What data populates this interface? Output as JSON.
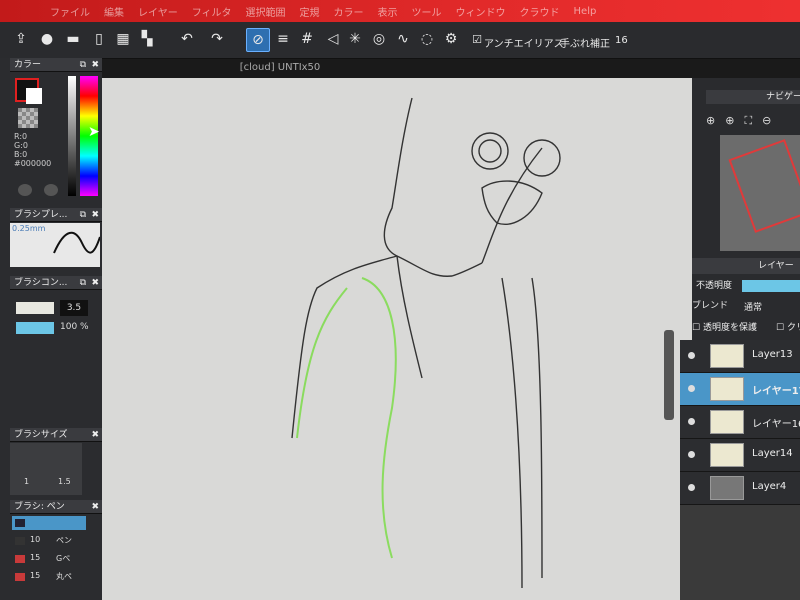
{
  "menu": [
    "ファイル",
    "編集",
    "レイヤー",
    "フィルタ",
    "選択範囲",
    "定規",
    "カラー",
    "表示",
    "ツール",
    "ウィンドウ",
    "クラウド",
    "Help"
  ],
  "document": {
    "title": "[cloud] UNTIx50"
  },
  "toolbar": {
    "antialias": "アンチエイリアス",
    "stabilizer": "手ぶれ補正",
    "stabilizer_value": "16"
  },
  "color_panel": {
    "title": "カラー",
    "r": "R:0",
    "g": "G:0",
    "b": "B:0",
    "hex": "#000000"
  },
  "brush_preview": {
    "title": "ブラシプレ...",
    "size": "0.25mm"
  },
  "brush_control": {
    "title": "ブラシコン...",
    "size_value": "3.5",
    "opacity_value": "100 %"
  },
  "brush_size": {
    "title": "ブラシサイズ",
    "sizes": [
      "1",
      "1.5"
    ]
  },
  "brush_list": {
    "title": "ブラシ: ペン",
    "items": [
      {
        "size": "",
        "name": ""
      },
      {
        "size": "10",
        "name": "ペン"
      },
      {
        "size": "15",
        "name": "Gペ"
      },
      {
        "size": "15",
        "name": "丸ペ"
      }
    ]
  },
  "navigator": {
    "title": "ナビゲー"
  },
  "layer_panel": {
    "title": "レイヤー",
    "opacity_label": "不透明度",
    "blend_label": "ブレンド",
    "blend_value": "通常",
    "protect_alpha": "透明度を保護",
    "clipping": "クリ",
    "layers": [
      {
        "name": "Layer13",
        "selected": false
      },
      {
        "name": "レイヤー17",
        "selected": true
      },
      {
        "name": "レイヤー16",
        "selected": false
      },
      {
        "name": "Layer14",
        "selected": false
      },
      {
        "name": "Layer4",
        "selected": false
      }
    ]
  },
  "colors": {
    "accent": "#2e6fb0",
    "selection": "#4a96c8",
    "title_bar": "#e22a2a",
    "sketch_green": "#7ddc4a"
  }
}
